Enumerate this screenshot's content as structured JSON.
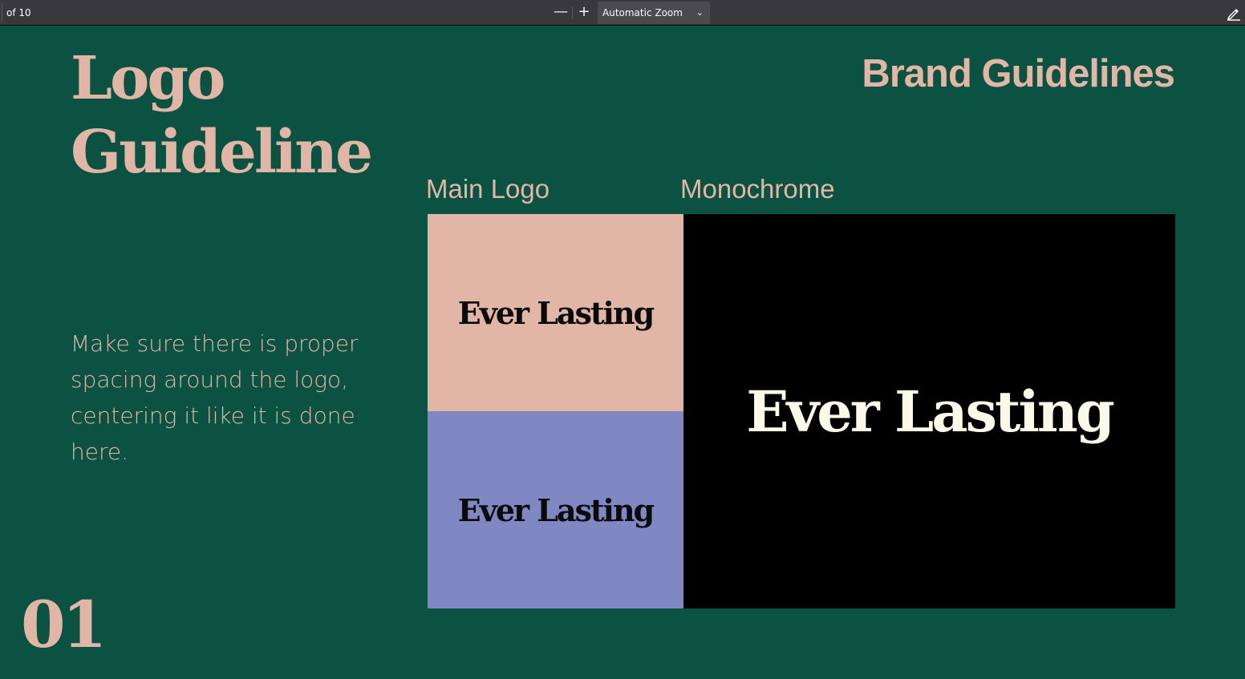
{
  "toolbar": {
    "page_count": "of 10",
    "zoom_out_label": "—",
    "zoom_in_label": "+",
    "zoom_value": "Automatic Zoom",
    "icons": [
      "minus-icon",
      "plus-icon",
      "chevron-down-icon",
      "pen-icon"
    ]
  },
  "slide": {
    "title_line1": "Logo",
    "title_line2": "Guideline",
    "brand": "Brand Guidelines",
    "main_logo_label": "Main Logo",
    "monochrome_label": "Monochrome",
    "description": "Make sure there is proper spacing around the logo, centering it like it is done here.",
    "page_number": "01",
    "logo_text": "Ever Lasting",
    "colors": {
      "background": "#0c5242",
      "accent": "#e2b6a6",
      "pink_panel": "#e2b6a6",
      "blue_panel": "#7f88c3",
      "black_panel": "#000000",
      "mono_logo": "#fbf9e8"
    }
  }
}
